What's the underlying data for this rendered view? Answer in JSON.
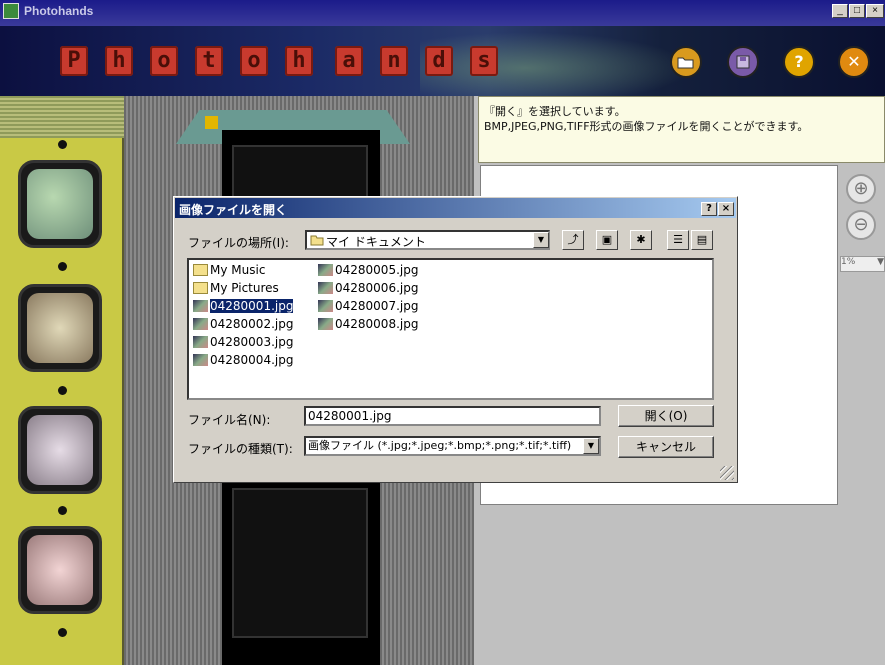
{
  "window": {
    "title": "Photohands",
    "min": "_",
    "max": "□",
    "close": "×"
  },
  "header": {
    "logo_letters": [
      "P",
      "h",
      "o",
      "t",
      "o",
      "h",
      "a",
      "n",
      "d",
      "s"
    ],
    "buttons": [
      {
        "name": "open",
        "icon": "folder-open-icon",
        "color": "#d99a1e"
      },
      {
        "name": "save",
        "icon": "floppy-icon",
        "color": "#7a5aa8"
      },
      {
        "name": "help",
        "icon": "question-icon",
        "color": "#e0a400",
        "glyph": "?"
      },
      {
        "name": "close",
        "icon": "close-icon",
        "color": "#e08a10",
        "glyph": "✕"
      }
    ]
  },
  "info": {
    "line1": "『開く』を選択しています。",
    "line2": "BMP,JPEG,PNG,TIFF形式の画像ファイルを開くことができます。"
  },
  "zoom": {
    "value": "1%"
  },
  "dialog": {
    "title": "画像ファイルを開く",
    "help_btn": "?",
    "close_btn": "×",
    "lookin_label": "ファイルの場所(I):",
    "lookin_value": "マイ ドキュメント",
    "files": [
      {
        "name": "My Music",
        "type": "folder"
      },
      {
        "name": "My Pictures",
        "type": "folder"
      },
      {
        "name": "04280001.jpg",
        "type": "image",
        "selected": true
      },
      {
        "name": "04280002.jpg",
        "type": "image"
      },
      {
        "name": "04280003.jpg",
        "type": "image"
      },
      {
        "name": "04280004.jpg",
        "type": "image"
      },
      {
        "name": "04280005.jpg",
        "type": "image"
      },
      {
        "name": "04280006.jpg",
        "type": "image"
      },
      {
        "name": "04280007.jpg",
        "type": "image"
      },
      {
        "name": "04280008.jpg",
        "type": "image"
      }
    ],
    "filename_label": "ファイル名(N):",
    "filename_value": "04280001.jpg",
    "filetype_label": "ファイルの種類(T):",
    "filetype_value": "画像ファイル (*.jpg;*.jpeg;*.bmp;*.png;*.tif;*.tiff)",
    "open_button": "開く(O)",
    "cancel_button": "キャンセル"
  },
  "colors": {
    "dialog_title_start": "#0a246a",
    "dialog_title_end": "#a6caf0",
    "strip": "#c9c945",
    "selection": "#0a246a"
  }
}
